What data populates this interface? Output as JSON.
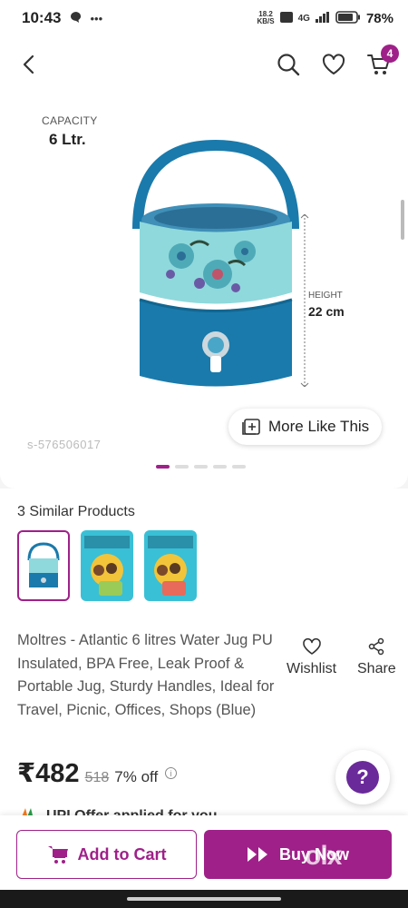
{
  "status_bar": {
    "time": "10:43",
    "left_icons": [
      "chat-bubble-icon",
      "more-dots-icon"
    ],
    "net_speed_value": "18.2",
    "net_speed_unit": "KB/S",
    "network": "4G",
    "battery": "78%"
  },
  "header": {
    "cart_count": "4",
    "icons": [
      "back-arrow-icon",
      "search-icon",
      "heart-icon",
      "cart-icon"
    ]
  },
  "product_image": {
    "capacity_label": "CAPACITY",
    "capacity_value": "6 Ltr.",
    "height_label": "HEIGHT",
    "height_value": "22 cm",
    "sku": "s-576506017",
    "more_like_this": "More Like This",
    "carousel_total": 5,
    "carousel_active": 1
  },
  "similar": {
    "title": "3 Similar Products",
    "count": 3
  },
  "product": {
    "title": "Moltres - Atlantic 6 litres Water Jug PU Insulated, BPA Free, Leak Proof & Portable Jug, Sturdy Handles, Ideal for Travel, Picnic, Offices, Shops (Blue)",
    "wishlist_label": "Wishlist",
    "share_label": "Share",
    "price": "₹482",
    "mrp": "518",
    "discount": "7% off",
    "upi_text": "UPI Offer applied for you"
  },
  "actions": {
    "add_to_cart": "Add to Cart",
    "buy_now": "Buy Now"
  },
  "colors": {
    "brand": "#9f2089",
    "jug_top": "#8fd9dc",
    "jug_bottom": "#1a7aab"
  },
  "watermark": "olx"
}
